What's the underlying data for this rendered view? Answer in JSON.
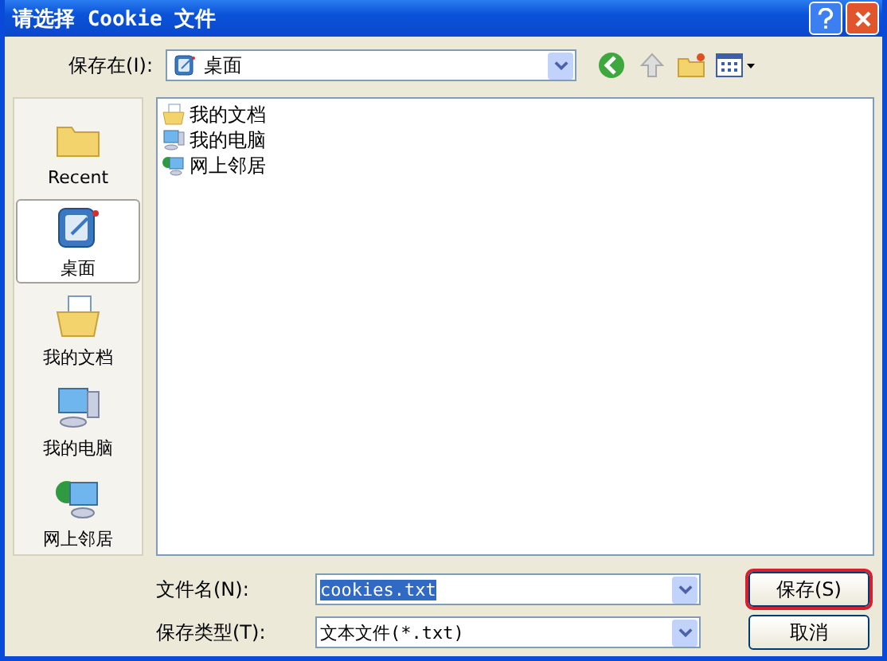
{
  "window": {
    "title": "请选择 Cookie 文件"
  },
  "save_in": {
    "label": "保存在(I):",
    "value": "桌面",
    "kind": "desktop"
  },
  "places": [
    {
      "label": "Recent",
      "kind": "recent",
      "selected": false
    },
    {
      "label": "桌面",
      "kind": "desktop",
      "selected": true
    },
    {
      "label": "我的文档",
      "kind": "documents",
      "selected": false
    },
    {
      "label": "我的电脑",
      "kind": "computer",
      "selected": false
    },
    {
      "label": "网上邻居",
      "kind": "network",
      "selected": false
    }
  ],
  "files": [
    {
      "name": "我的文档",
      "kind": "documents"
    },
    {
      "name": "我的电脑",
      "kind": "computer"
    },
    {
      "name": "网上邻居",
      "kind": "network"
    }
  ],
  "file_name": {
    "label": "文件名(N):",
    "value": "cookies.txt",
    "selected": true
  },
  "file_type": {
    "label": "保存类型(T):",
    "value": "文本文件(*.txt)"
  },
  "buttons": [
    {
      "label": "保存(S)",
      "highlighted": true
    },
    {
      "label": "取消",
      "highlighted": false
    }
  ]
}
